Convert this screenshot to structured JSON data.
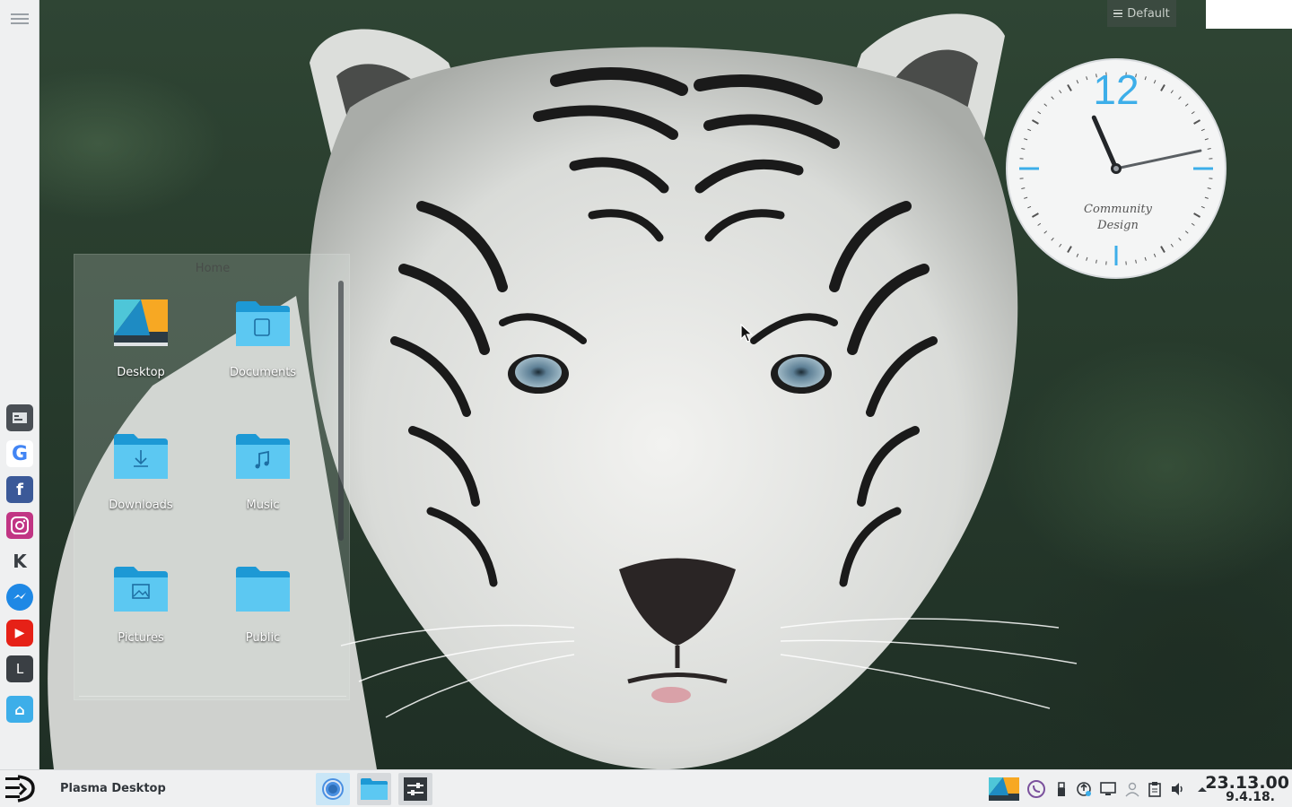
{
  "desktop": {
    "toolbox_label": "Default",
    "cursor_icon": "arrow-pointer"
  },
  "left_dock": {
    "menu_icon": "hamburger-menu-icon",
    "items": [
      {
        "name": "Terminal",
        "icon": "terminal-icon",
        "glyph": "",
        "color": "#4a4f55"
      },
      {
        "name": "Google",
        "icon": "google-icon",
        "glyph": "G",
        "color": "#ffffff"
      },
      {
        "name": "Facebook",
        "icon": "facebook-icon",
        "glyph": "f",
        "color": "#3b5998"
      },
      {
        "name": "Instagram",
        "icon": "instagram-icon",
        "glyph": "",
        "color": "#c13584"
      },
      {
        "name": "KDE",
        "icon": "kde-icon",
        "glyph": "K",
        "color": "#eff0f1"
      },
      {
        "name": "Messenger",
        "icon": "messenger-icon",
        "glyph": "",
        "color": "#1e88e5"
      },
      {
        "name": "YouTube",
        "icon": "youtube-icon",
        "glyph": "▶",
        "color": "#e62117"
      },
      {
        "name": "L",
        "icon": "l-app-icon",
        "glyph": "L",
        "color": "#3a3f44"
      },
      {
        "name": "Home",
        "icon": "home-folder-icon",
        "glyph": "⌂",
        "color": "#3daee9"
      }
    ]
  },
  "folder_view": {
    "title": "Home",
    "items": [
      {
        "label": "Desktop",
        "icon": "desktop-folder-icon"
      },
      {
        "label": "Documents",
        "icon": "documents-folder-icon"
      },
      {
        "label": "Downloads",
        "icon": "downloads-folder-icon"
      },
      {
        "label": "Music",
        "icon": "music-folder-icon"
      },
      {
        "label": "Pictures",
        "icon": "pictures-folder-icon"
      },
      {
        "label": "Public",
        "icon": "public-folder-icon"
      }
    ]
  },
  "clock_widget": {
    "number": "12",
    "brand_line1": "Community",
    "brand_line2": "Design",
    "hour": 11,
    "minute": 13,
    "accent_color": "#3daee9"
  },
  "taskbar": {
    "launcher_icon": "kde-launcher-icon",
    "active_window_title": "Plasma Desktop",
    "tasks": [
      {
        "name": "Chromium",
        "icon": "chromium-icon"
      },
      {
        "name": "Files",
        "icon": "file-manager-icon"
      },
      {
        "name": "Settings",
        "icon": "system-settings-icon"
      }
    ],
    "tray": [
      {
        "name": "Plasma",
        "icon": "plasma-tray-icon"
      },
      {
        "name": "Viber",
        "icon": "viber-icon"
      },
      {
        "name": "USB",
        "icon": "usb-device-icon"
      },
      {
        "name": "Updates",
        "icon": "updates-icon"
      },
      {
        "name": "Network",
        "icon": "network-icon"
      },
      {
        "name": "User",
        "icon": "user-icon"
      },
      {
        "name": "Clipboard",
        "icon": "clipboard-icon"
      },
      {
        "name": "Volume",
        "icon": "volume-icon"
      },
      {
        "name": "Expand",
        "icon": "expand-tray-arrow-icon"
      }
    ],
    "time": "23.13.00",
    "date": "9.4.18."
  }
}
